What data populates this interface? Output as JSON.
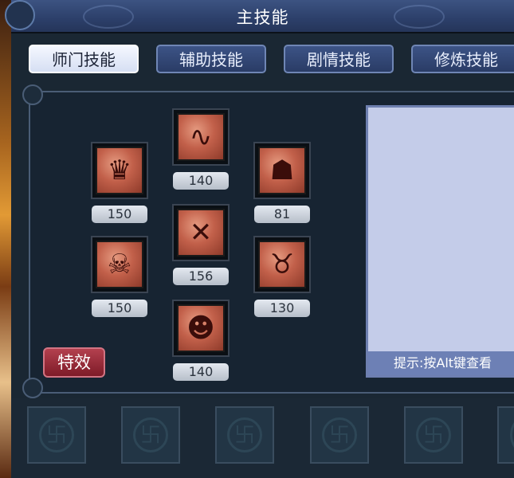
{
  "window": {
    "title": "主技能"
  },
  "tabs": [
    {
      "label": "师门技能",
      "active": true
    },
    {
      "label": "辅助技能",
      "active": false
    },
    {
      "label": "剧情技能",
      "active": false
    },
    {
      "label": "修炼技能",
      "active": false
    }
  ],
  "skills": [
    {
      "icon": "crown-demon-icon",
      "glyph": "♛",
      "level": "150"
    },
    {
      "icon": "whip-icon",
      "glyph": "∿",
      "level": "140"
    },
    {
      "icon": "mask-scroll-icon",
      "glyph": "☗",
      "level": "81"
    },
    {
      "icon": "caged-demon-icon",
      "glyph": "☠",
      "level": "150"
    },
    {
      "icon": "slash-orb-icon",
      "glyph": "✕",
      "level": "156"
    },
    {
      "icon": "wings-icon",
      "glyph": "♉",
      "level": "130"
    },
    {
      "icon": "beast-head-icon",
      "glyph": "☻",
      "level": "140"
    }
  ],
  "effect_button": {
    "label": "特效"
  },
  "description": {
    "hint": "提示:按Alt键查看"
  },
  "quick_slots": [
    {
      "icon": "empty-slot-icon",
      "glyph": "卐"
    },
    {
      "icon": "empty-slot-icon",
      "glyph": "卐"
    },
    {
      "icon": "empty-slot-icon",
      "glyph": "卐"
    },
    {
      "icon": "empty-slot-icon",
      "glyph": "卐"
    },
    {
      "icon": "empty-slot-icon",
      "glyph": "卐"
    },
    {
      "icon": "empty-slot-icon",
      "glyph": "卐"
    }
  ],
  "colors": {
    "accent": "#3c5382",
    "skill_tile": "#c2604a",
    "effect_button": "#7e1b28",
    "description_bg": "#c4cce9"
  }
}
